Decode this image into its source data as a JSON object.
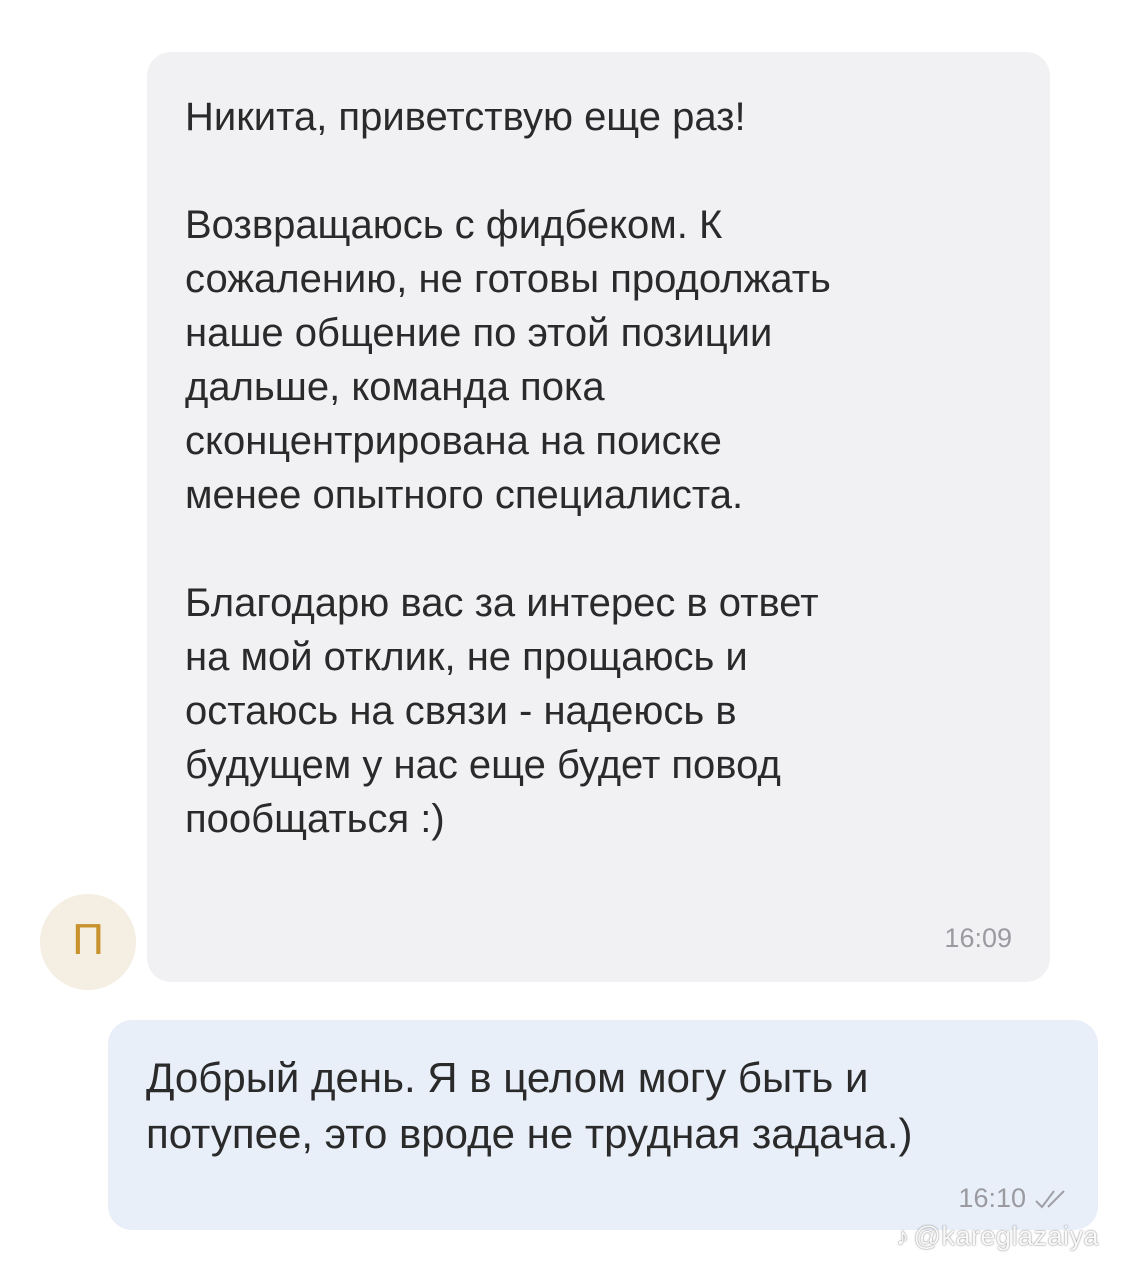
{
  "contact": {
    "avatar_letter": "П",
    "avatar_color": "#c8922e"
  },
  "messages": [
    {
      "direction": "incoming",
      "text": "Никита, приветствую еще раз!\n\nВозвращаюсь с фидбеком. К\nсожалению, не готовы продолжать\nнаше общение по этой позиции\nдальше, команда пока\nсконцентрирована на поиске\nменее опытного специалиста.\n\nБлагодарю вас за интерес в ответ\nна мой отклик, не прощаюсь и\nостаюсь на связи - надеюсь в\nбудущем у нас еще будет повод\nпообщаться :)",
      "time": "16:09"
    },
    {
      "direction": "outgoing",
      "text": "Добрый день. Я в целом могу быть и\nпотупее, это вроде не трудная задача.)",
      "time": "16:10",
      "status_icon": "double-check-icon"
    }
  ],
  "watermark": {
    "icon": "tiktok-icon",
    "handle": "@kareglazaiya"
  }
}
